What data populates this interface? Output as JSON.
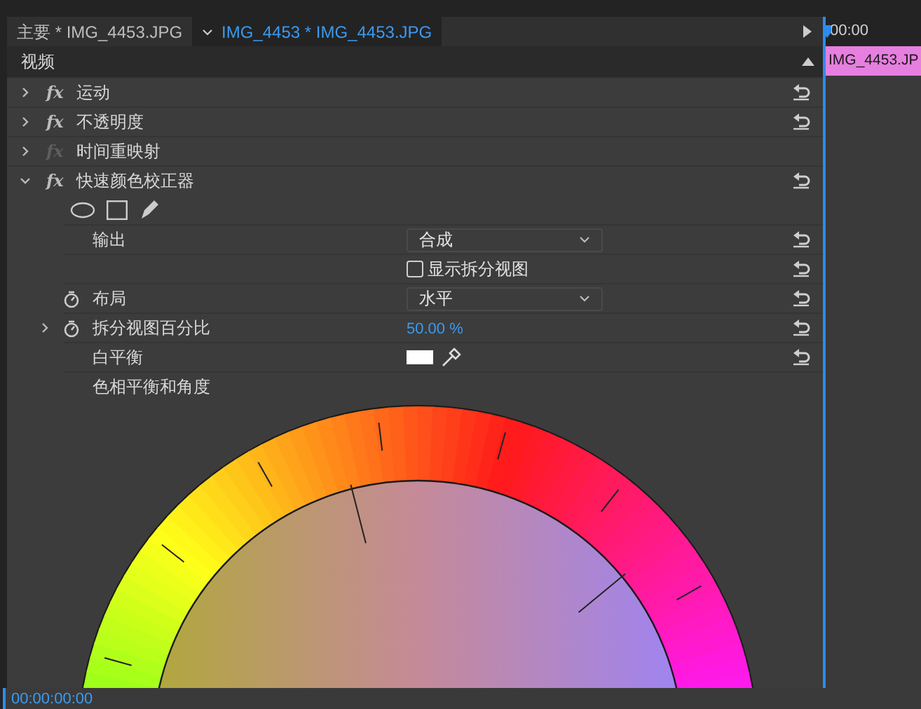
{
  "tabs": [
    {
      "label": "主要 * IMG_4453.JPG",
      "selected": false,
      "menu": false
    },
    {
      "label": "IMG_4453 * IMG_4453.JPG",
      "selected": true,
      "menu": true
    }
  ],
  "section": {
    "label": "视频",
    "expanded": true
  },
  "effects": [
    {
      "badge": "fx",
      "name": "运动",
      "expanded": false,
      "enabled": true,
      "resettable": true
    },
    {
      "badge": "fx",
      "name": "不透明度",
      "expanded": false,
      "enabled": true,
      "resettable": true
    },
    {
      "badge": "fx",
      "name": "时间重映射",
      "expanded": false,
      "enabled": false,
      "resettable": false
    },
    {
      "badge": "fx",
      "name": "快速颜色校正器",
      "expanded": true,
      "enabled": true,
      "resettable": true
    }
  ],
  "properties": [
    {
      "kind": "masks"
    },
    {
      "kind": "dropdown",
      "label": "输出",
      "value": "合成",
      "stopwatch": false,
      "resettable": true
    },
    {
      "kind": "checkbox",
      "label": "显示拆分视图",
      "checked": false,
      "resettable": true
    },
    {
      "kind": "dropdown",
      "label": "布局",
      "value": "水平",
      "stopwatch": true,
      "resettable": true
    },
    {
      "kind": "number",
      "label": "拆分视图百分比",
      "value": "50.00",
      "unit": "%",
      "stopwatch": true,
      "expandable": true,
      "resettable": true
    },
    {
      "kind": "color",
      "label": "白平衡",
      "resettable": true
    },
    {
      "kind": "heading",
      "label": "色相平衡和角度",
      "resettable": false
    }
  ],
  "timeline": {
    "ruler_label": "00:00",
    "clip": "IMG_4453.JP"
  },
  "timecode": "00:00:00:00"
}
